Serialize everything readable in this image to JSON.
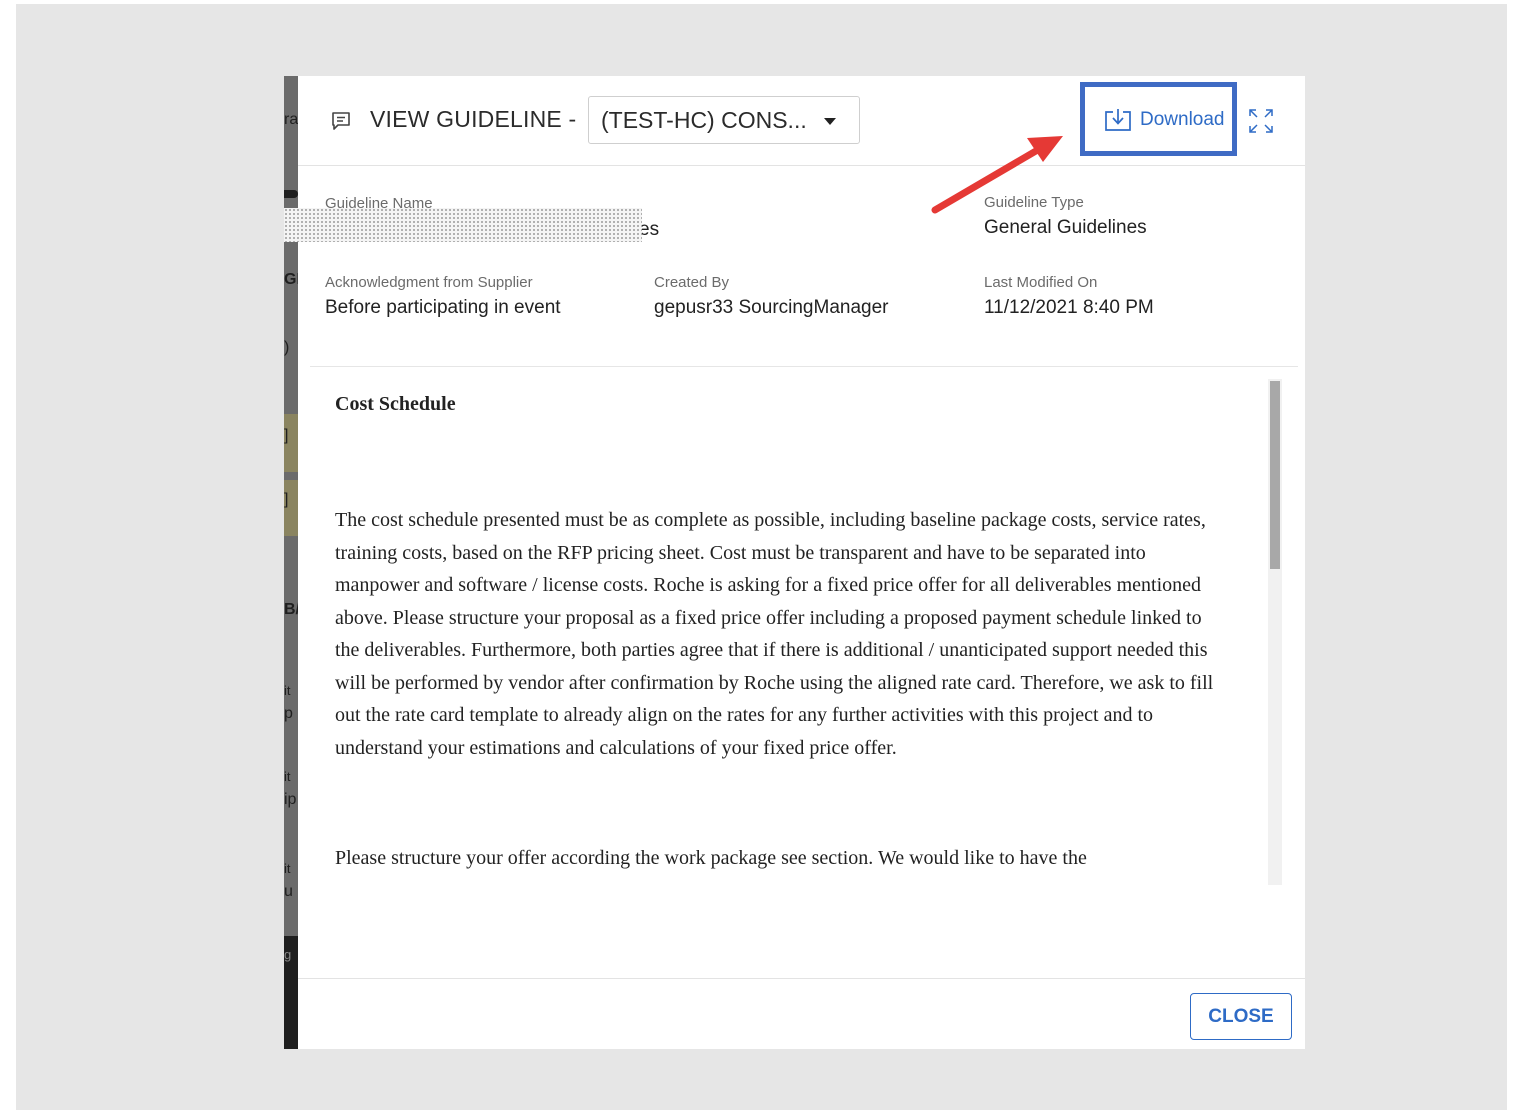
{
  "header": {
    "title": "VIEW GUIDELINE -",
    "selector_value": "(TEST-HC) CONS...",
    "download_label": "Download",
    "icons": {
      "title": "comment-icon",
      "download": "download-icon",
      "expand": "expand-icon",
      "dropdown": "caret-down-icon"
    }
  },
  "meta": {
    "guideline_name_label": "Guideline Name",
    "guideline_name_value_visible": "es",
    "guideline_type_label": "Guideline Type",
    "guideline_type_value": "General Guidelines",
    "ack_label": "Acknowledgment from Supplier",
    "ack_value": "Before participating in event",
    "created_by_label": "Created By",
    "created_by_value": "gepusr33 SourcingManager",
    "modified_label": "Last Modified On",
    "modified_value": "11/12/2021 8:40 PM"
  },
  "content": {
    "heading": "Cost Schedule",
    "paragraph1": "The cost schedule presented must be as complete as possible, including baseline package costs, service rates, training costs, based on the RFP pricing sheet. Cost must be transparent and have to be separated into manpower and software / license costs. Roche is asking for a fixed price offer for all deliverables mentioned above. Please structure your proposal as a fixed price offer including a proposed payment schedule linked to the deliverables. Furthermore, both parties agree that if there is additional / unanticipated support needed this will be performed by vendor after confirmation by Roche using the aligned rate card. Therefore, we ask to fill out the rate card template to already align on the rates for any further activities with this project and to understand your estimations and calculations of your fixed price offer.",
    "paragraph2": "Please structure your offer according the work package see section. We would like to have the"
  },
  "footer": {
    "close_label": "CLOSE"
  },
  "backdrop": {
    "glyphs": [
      "ra",
      "GI",
      ")",
      "]",
      "]",
      "B/",
      "it",
      "p",
      "it",
      "ip",
      "it",
      "u",
      "g"
    ]
  },
  "colors": {
    "accent": "#2e6bc6",
    "highlight_box": "#3f6bc4",
    "annotation_arrow": "#e53935"
  }
}
